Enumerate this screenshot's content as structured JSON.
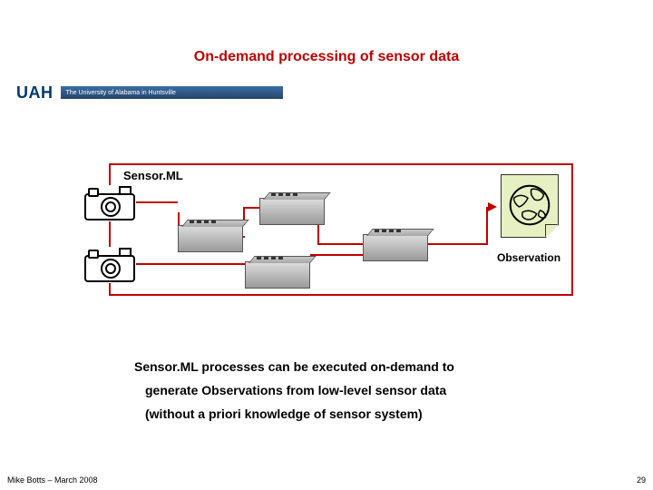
{
  "title": "On-demand processing of sensor data",
  "logo": {
    "main": "UAH",
    "sub": "The University of Alabama in Huntsville"
  },
  "diagram": {
    "frame_label": "Sensor.ML",
    "output_label": "Observation"
  },
  "body": {
    "line1": "Sensor.ML processes can be executed on-demand to",
    "line2": "generate Observations from low-level sensor data",
    "line3": "(without a priori knowledge of sensor system)"
  },
  "footer": "Mike Botts – March 2008",
  "page_number": "29"
}
